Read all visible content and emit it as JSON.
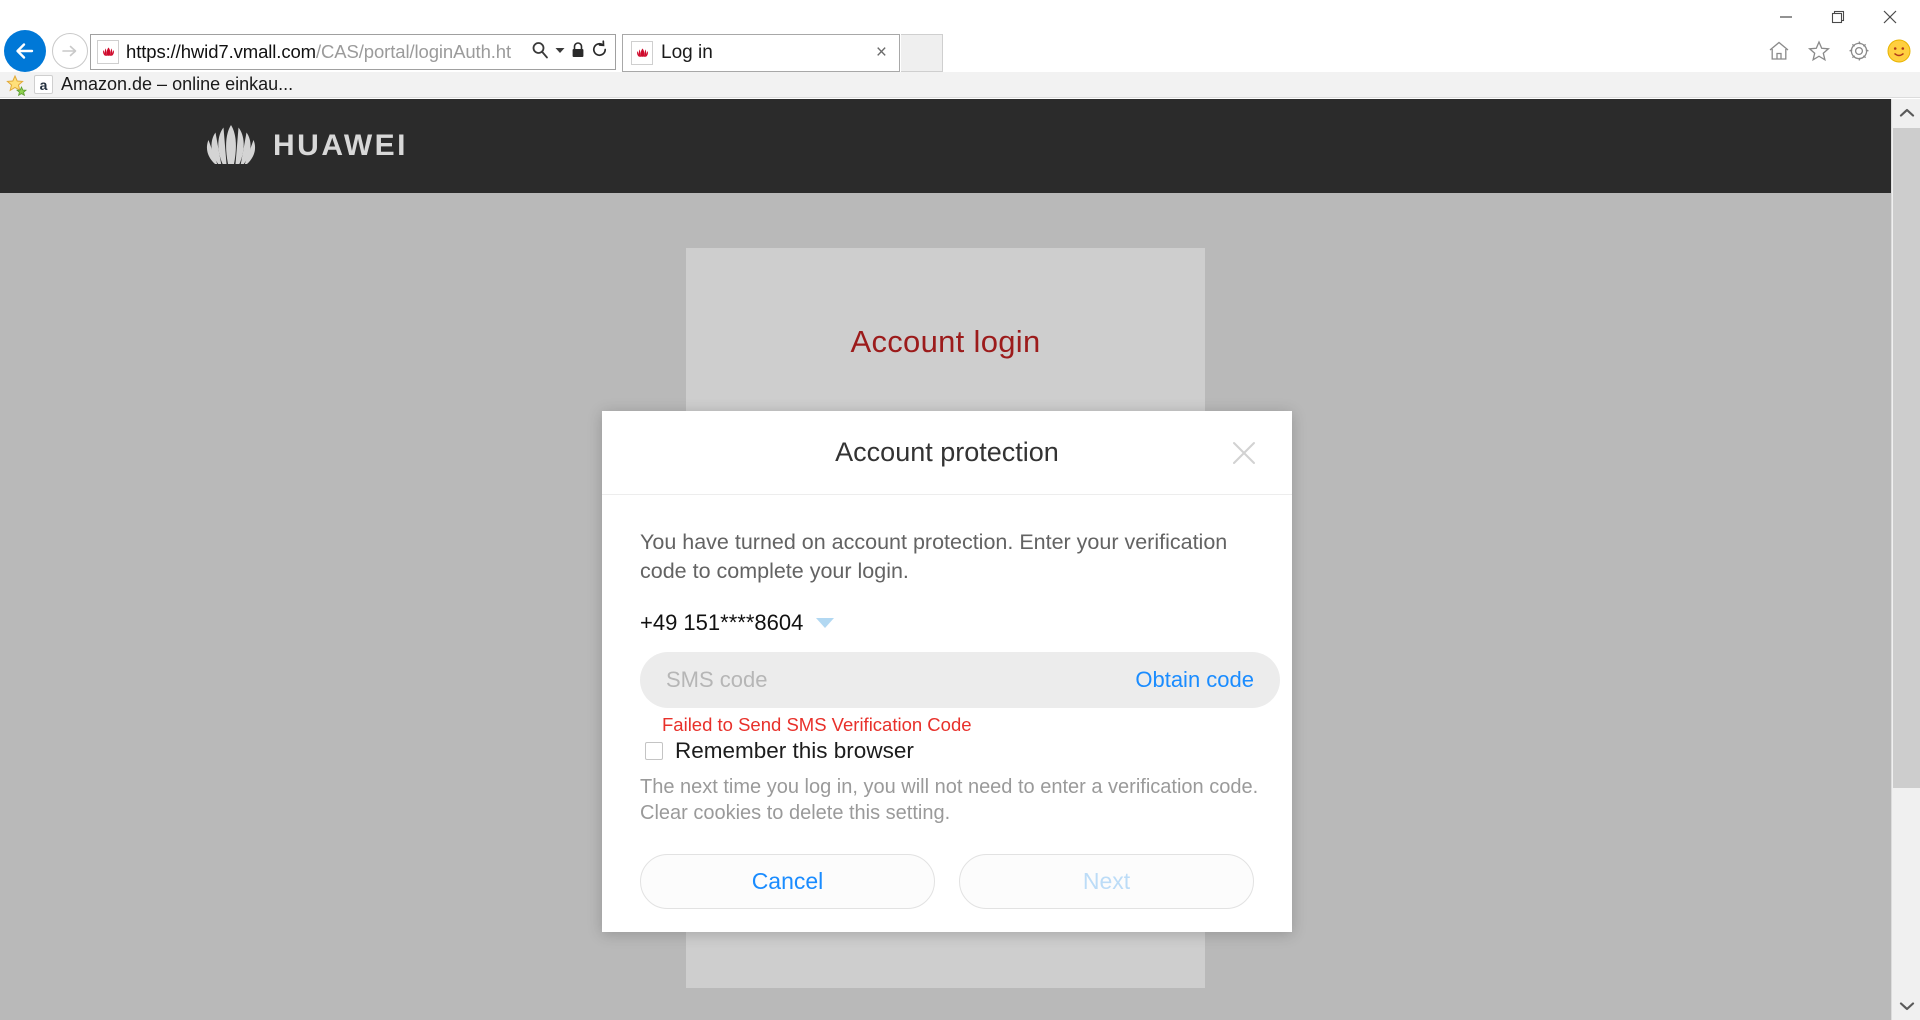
{
  "browser": {
    "url_prefix": "https://",
    "url_domain": "hwid7.vmall.com",
    "url_path": "/CAS/portal/loginAuth.ht",
    "url_full": "https://hwid7.vmall.com/CAS/portal/loginAuth.ht",
    "tab_title": "Log in",
    "tab_close_glyph": "×",
    "back_icon": "back-arrow-icon",
    "forward_icon": "forward-arrow-icon",
    "search_icon": "search-magnifier-icon",
    "dropdown_icon": "chevron-down-icon",
    "lock_icon": "padlock-icon",
    "refresh_icon": "refresh-icon",
    "window_minimize": "—",
    "window_maximize": "restore-icon",
    "window_close": "✕",
    "toolbar_icons": [
      "home-icon",
      "favorites-star-icon",
      "settings-gear-icon",
      "profile-smiley-icon"
    ]
  },
  "bookmarks": {
    "star_icon": "favorites-star-icon",
    "items": [
      {
        "favicon_letter": "a",
        "label": "Amazon.de – online einkau..."
      }
    ]
  },
  "page": {
    "brand": "HUAWEI",
    "brand_logo_icon": "huawei-flower-logo-icon",
    "card_title": "Account login"
  },
  "modal": {
    "title": "Account protection",
    "close_icon": "close-x-icon",
    "description": "You have turned on account protection. Enter your verification code to complete your login.",
    "phone": "+49 151****8604",
    "phone_caret_icon": "chevron-down-icon",
    "sms_placeholder": "SMS code",
    "sms_value": "",
    "obtain_code_label": "Obtain code",
    "error_message": "Failed to Send SMS Verification Code",
    "remember_label": "Remember this browser",
    "remember_checked": false,
    "remember_help": "The next time you log in, you will not need to enter a verification code. Clear cookies to delete this setting.",
    "cancel_label": "Cancel",
    "next_label": "Next"
  },
  "scrollbar": {
    "up_icon": "chevron-up-icon",
    "down_icon": "chevron-down-icon"
  },
  "colors": {
    "accent_blue": "#1a8cff",
    "error_red": "#e8302a",
    "brand_red": "#9c1b1b",
    "header_dark": "#2b2b2b",
    "page_gray": "#b9b9b9"
  }
}
